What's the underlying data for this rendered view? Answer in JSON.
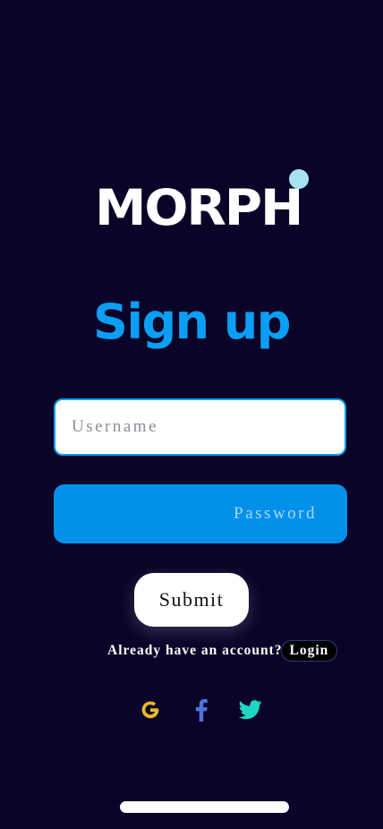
{
  "brand": {
    "name": "MORPH",
    "dot_color": "#a6e3f1"
  },
  "page": {
    "title": "Sign up",
    "title_color": "#0a9ff5",
    "background": "#0a0428"
  },
  "form": {
    "username": {
      "value": "",
      "placeholder": "Username"
    },
    "password": {
      "value": "",
      "placeholder": "Password",
      "background": "#0290ea"
    },
    "submit_label": "Submit"
  },
  "login": {
    "prompt": "Already have an account?",
    "button_label": "Login"
  },
  "social": [
    {
      "icon": "google-icon",
      "color": "#e9b92c"
    },
    {
      "icon": "facebook-icon",
      "color": "#4f73d9"
    },
    {
      "icon": "twitter-icon",
      "color": "#1fd6c4"
    }
  ]
}
